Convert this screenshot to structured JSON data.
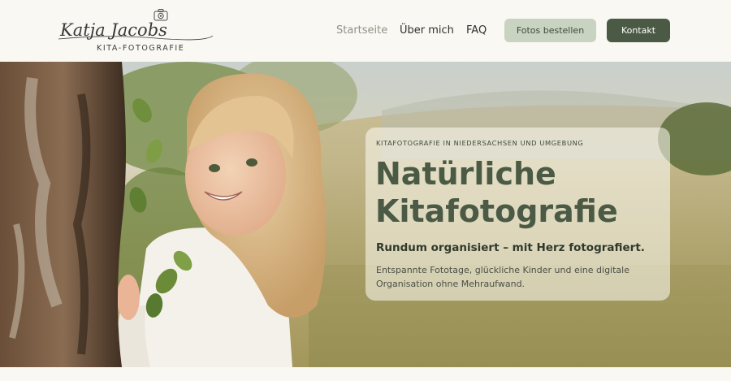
{
  "brand": {
    "logo_script": "Katja Jacobs",
    "logo_sub": "KITA-FOTOGRAFIE"
  },
  "nav": {
    "items": [
      {
        "label": "Startseite",
        "active": true
      },
      {
        "label": "Über mich"
      },
      {
        "label": "FAQ"
      }
    ],
    "order_button": "Fotos bestellen",
    "contact_button": "Kontakt"
  },
  "hero": {
    "eyebrow": "KITAFOTOGRAFIE IN NIEDERSACHSEN UND UMGEBUNG",
    "title": "Natürliche Kitafotografie",
    "subtitle": "Rundum organisiert – mit Herz fotografiert.",
    "text": "Entspannte Fototage, glückliche Kinder und eine digitale Organisation ohne Mehraufwand.",
    "image_icon": "photo-child-by-tree"
  },
  "colors": {
    "accent": "#4a5a44",
    "accent_light": "#c9d3c1",
    "background": "#faf8f3"
  }
}
